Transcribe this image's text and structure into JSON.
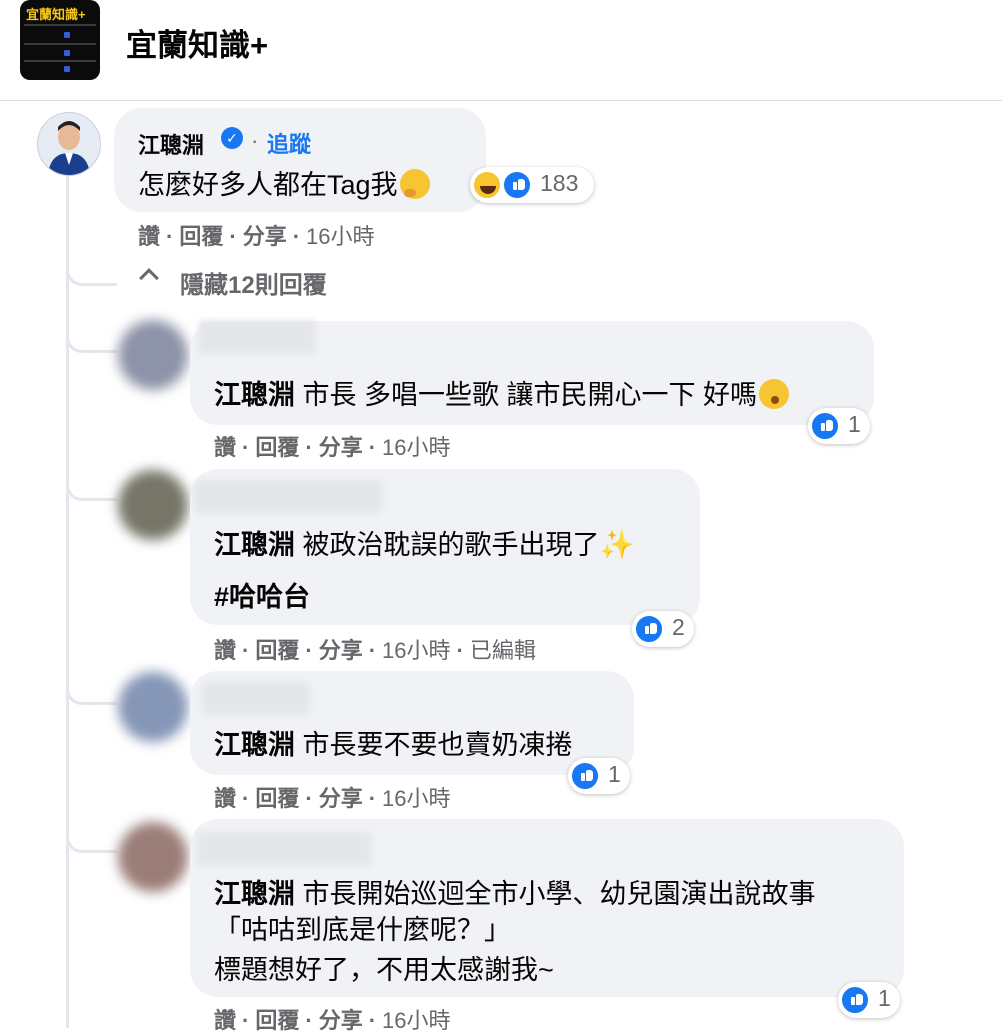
{
  "page": {
    "name": "宜蘭知識+",
    "logo_text": "宜蘭知識+"
  },
  "main_comment": {
    "author": "江聰淵",
    "follow_label": "追蹤",
    "text": "怎麼好多人都在Tag我",
    "reaction_count": "183",
    "actions": {
      "like": "讚",
      "reply": "回覆",
      "share": "分享",
      "time": "16小時"
    }
  },
  "hide_replies_label": "隱藏12則回覆",
  "replies": [
    {
      "tag": "江聰淵",
      "lines": [
        "市長 多唱一些歌 讓市民開心一下 好嗎"
      ],
      "reaction_count": "1",
      "actions": {
        "like": "讚",
        "reply": "回覆",
        "share": "分享",
        "time": "16小時"
      }
    },
    {
      "tag": "江聰淵",
      "lines": [
        "被政治耽誤的歌手出現了",
        "#哈哈台"
      ],
      "reaction_count": "2",
      "actions": {
        "like": "讚",
        "reply": "回覆",
        "share": "分享",
        "time": "16小時",
        "edited": "已編輯"
      }
    },
    {
      "tag": "江聰淵",
      "lines": [
        "市長要不要也賣奶凍捲"
      ],
      "reaction_count": "1",
      "actions": {
        "like": "讚",
        "reply": "回覆",
        "share": "分享",
        "time": "16小時"
      }
    },
    {
      "tag": "江聰淵",
      "lines": [
        "市長開始巡迴全市小學、幼兒園演出說故事",
        "「咕咕到底是什麼呢？」",
        "標題想好了，不用太感謝我~"
      ],
      "reaction_count": "1",
      "actions": {
        "like": "讚",
        "reply": "回覆",
        "share": "分享",
        "time": "16小時"
      }
    }
  ],
  "icons": [
    "verified-badge-icon",
    "like-reaction-icon",
    "haha-reaction-icon",
    "chevron-up-icon",
    "thinking-face-emoji",
    "hushed-face-emoji",
    "sparkles-emoji"
  ],
  "colors": {
    "link": "#1877f2",
    "bubble": "#f0f2f5",
    "meta": "#65676b"
  }
}
